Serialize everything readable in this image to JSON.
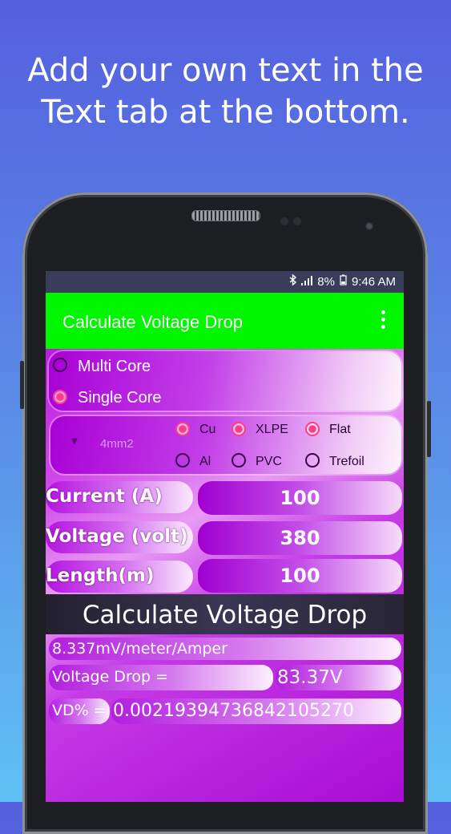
{
  "promo": {
    "line1": "Add your own text in the",
    "line2": "Text tab at the bottom."
  },
  "statusbar": {
    "battery": "8%",
    "time": "9:46 AM",
    "icons": [
      "bluetooth-icon",
      "signal-icon",
      "battery-icon"
    ]
  },
  "appbar": {
    "title": "Calculate Voltage Drop",
    "menu_icon": "more-vert-icon"
  },
  "core_type": {
    "options": [
      "Multi Core",
      "Single Core"
    ],
    "selected": "Single Core"
  },
  "cable": {
    "size_selected": "4mm2",
    "conductor": {
      "options": [
        "Cu",
        "Al"
      ],
      "selected": "Cu"
    },
    "insulation": {
      "options": [
        "XLPE",
        "PVC"
      ],
      "selected": "XLPE"
    },
    "arrangement": {
      "options": [
        "Flat",
        "Trefoil"
      ],
      "selected": "Flat"
    }
  },
  "fields": {
    "current": {
      "label": "Current (A)",
      "value": "100"
    },
    "voltage": {
      "label": "Voltage (volt)",
      "value": "380"
    },
    "length": {
      "label": "Length(m)",
      "value": "100"
    }
  },
  "calculate_button": "Calculate Voltage Drop",
  "results": {
    "rate": "8.337mV/meter/Amper",
    "vd_label": "Voltage Drop  =",
    "vd_value": "83.37V",
    "vdp_label": "VD% =",
    "vdp_value": "0.00219394736842105270"
  },
  "colors": {
    "appbar": "#00f700",
    "accent": "#ff3d7f",
    "statusbar": "#393d5a"
  }
}
